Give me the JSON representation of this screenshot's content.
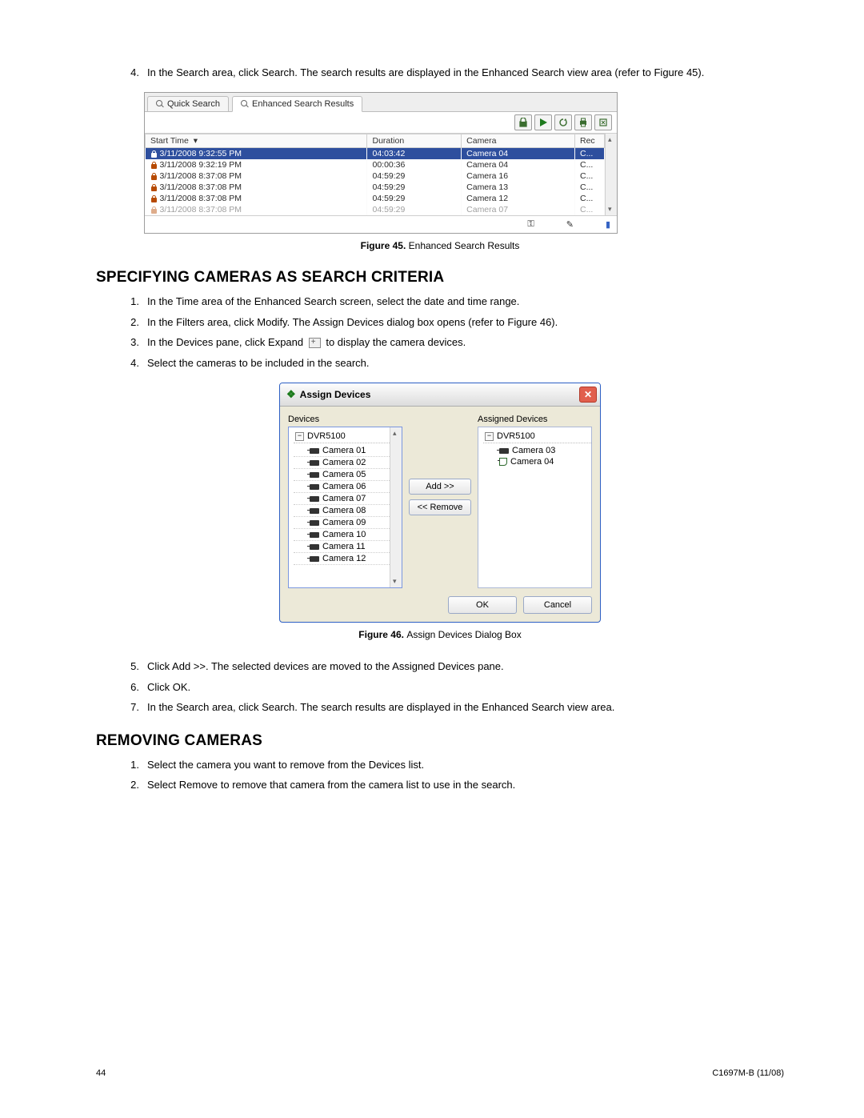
{
  "intro_step": {
    "num": "4.",
    "text": "In the Search area, click Search. The search results are displayed in the Enhanced Search view area (refer to Figure 45)."
  },
  "fig45": {
    "tabs": {
      "quick": "Quick Search",
      "enhanced": "Enhanced Search Results"
    },
    "columns": {
      "start": "Start Time",
      "duration": "Duration",
      "camera": "Camera",
      "rec": "Rec"
    },
    "rows": [
      {
        "start": "3/11/2008 9:32:55 PM",
        "duration": "04:03:42",
        "camera": "Camera 04",
        "rec": "C..."
      },
      {
        "start": "3/11/2008 9:32:19 PM",
        "duration": "00:00:36",
        "camera": "Camera 04",
        "rec": "C..."
      },
      {
        "start": "3/11/2008 8:37:08 PM",
        "duration": "04:59:29",
        "camera": "Camera 16",
        "rec": "C..."
      },
      {
        "start": "3/11/2008 8:37:08 PM",
        "duration": "04:59:29",
        "camera": "Camera 13",
        "rec": "C..."
      },
      {
        "start": "3/11/2008 8:37:08 PM",
        "duration": "04:59:29",
        "camera": "Camera 12",
        "rec": "C..."
      },
      {
        "start": "3/11/2008 8:37:08 PM",
        "duration": "04:59:29",
        "camera": "Camera 07",
        "rec": "C..."
      }
    ],
    "caption_label": "Figure 45.",
    "caption_text": "Enhanced Search Results"
  },
  "section1": {
    "heading": "SPECIFYING CAMERAS AS SEARCH CRITERIA",
    "steps_a": [
      {
        "num": "1.",
        "text": "In the Time area of the Enhanced Search screen, select the date and time range."
      },
      {
        "num": "2.",
        "text": "In the Filters area, click Modify. The Assign Devices dialog box opens (refer to Figure 46)."
      },
      {
        "num": "3.",
        "text_pre": "In the Devices pane, click Expand ",
        "text_post": " to display the camera devices."
      },
      {
        "num": "4.",
        "text": "Select the cameras to be included in the search."
      }
    ],
    "steps_b": [
      {
        "num": "5.",
        "text": "Click Add >>. The selected devices are moved to the Assigned Devices pane."
      },
      {
        "num": "6.",
        "text": "Click OK."
      },
      {
        "num": "7.",
        "text": "In the Search area, click Search. The search results are displayed in the Enhanced Search view area."
      }
    ]
  },
  "fig46": {
    "title": "Assign Devices",
    "left_label": "Devices",
    "right_label": "Assigned Devices",
    "root": "DVR5100",
    "left_items": [
      "Camera 01",
      "Camera 02",
      "Camera 05",
      "Camera 06",
      "Camera 07",
      "Camera 08",
      "Camera 09",
      "Camera 10",
      "Camera 11",
      "Camera 12"
    ],
    "right_items": [
      "Camera 03",
      "Camera 04"
    ],
    "add_btn": "Add >>",
    "remove_btn": "<< Remove",
    "ok_btn": "OK",
    "cancel_btn": "Cancel",
    "caption_label": "Figure 46.",
    "caption_text": "Assign Devices Dialog Box"
  },
  "section2": {
    "heading": "REMOVING CAMERAS",
    "steps": [
      {
        "num": "1.",
        "text": "Select the camera you want to remove from the Devices list."
      },
      {
        "num": "2.",
        "text": "Select Remove to remove that camera from the camera list to use in the search."
      }
    ]
  },
  "footer": {
    "page": "44",
    "doc": "C1697M-B (11/08)"
  }
}
